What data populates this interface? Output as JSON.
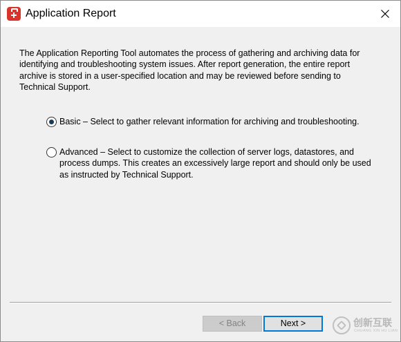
{
  "window": {
    "title": "Application Report"
  },
  "intro": {
    "text": "The Application Reporting Tool automates the process of gathering and archiving data for identifying and troubleshooting system issues. After report generation, the entire report archive is stored in a user-specified location and may be reviewed before sending to Technical Support."
  },
  "options": [
    {
      "label": "Basic – Select to gather relevant information for archiving and troubleshooting.",
      "selected": true
    },
    {
      "label": "Advanced – Select to customize the collection of server logs, datastores, and process dumps. This creates an excessively large report and should only be used as instructed by Technical Support.",
      "selected": false
    }
  ],
  "buttons": {
    "back_label": "< Back",
    "back_enabled": false,
    "next_label": "Next >",
    "next_enabled": true
  },
  "watermark": {
    "text_cn": "创新互联",
    "text_en": "CHUANG XIN HU LIAN"
  },
  "icons": {
    "app": "briefcase-medical-icon",
    "close": "close-icon",
    "watermark": "watermark-logo-icon"
  },
  "colors": {
    "title_bar": "#ffffff",
    "dialog_background": "#f0f0f0",
    "app_icon": "#d9342b",
    "default_button_border": "#0078d7",
    "disabled_text": "#838383"
  }
}
